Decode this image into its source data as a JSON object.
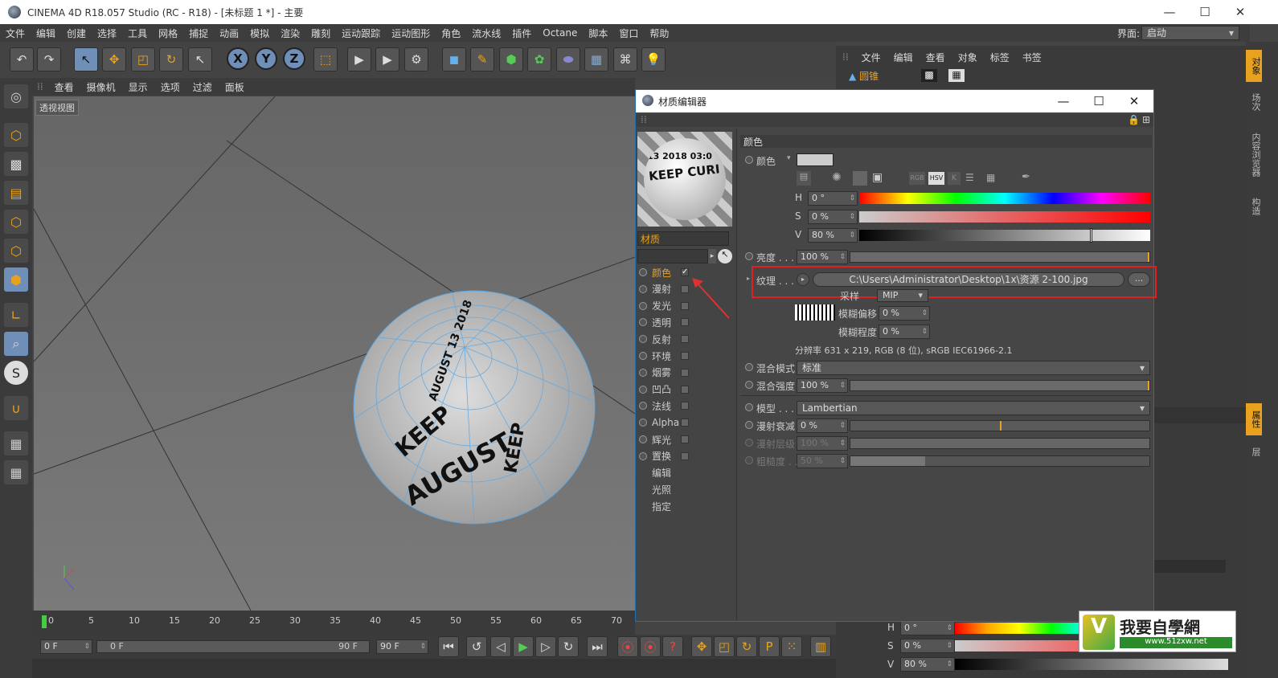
{
  "window": {
    "title": "CINEMA 4D R18.057 Studio (RC - R18) - [未标题 1 *] - 主要",
    "minimize": "—",
    "maximize": "☐",
    "close": "✕"
  },
  "menu": [
    "文件",
    "编辑",
    "创建",
    "选择",
    "工具",
    "网格",
    "捕捉",
    "动画",
    "模拟",
    "渲染",
    "雕刻",
    "运动跟踪",
    "运动图形",
    "角色",
    "流水线",
    "插件",
    "Octane",
    "脚本",
    "窗口",
    "帮助"
  ],
  "layout": {
    "label": "界面:",
    "value": "启动"
  },
  "axis": {
    "x": "X",
    "y": "Y",
    "z": "Z"
  },
  "viewport": {
    "menu": [
      "查看",
      "摄像机",
      "显示",
      "选项",
      "过滤",
      "面板"
    ],
    "label": "透视视图"
  },
  "timeline": {
    "ticks": [
      "0",
      "5",
      "10",
      "15",
      "20",
      "25",
      "30",
      "35",
      "40",
      "45",
      "50",
      "55",
      "60",
      "65",
      "70"
    ],
    "current": "0 F",
    "start": "0 F",
    "end": "90 F",
    "end_left": "90 F",
    "max": "90 F"
  },
  "right_panel": {
    "menu": [
      "文件",
      "编辑",
      "查看",
      "对象",
      "标签",
      "书签"
    ],
    "object": "圆锥",
    "tabs": [
      "对象",
      "场次",
      "内容浏览器",
      "构造",
      "属性",
      "层"
    ]
  },
  "bottom_right": {
    "h": "0 °",
    "s": "0 %",
    "v": "80 %",
    "h_label": "H",
    "s_label": "S",
    "v_label": "V"
  },
  "material_editor": {
    "title": "材质编辑器",
    "material_name": "材质",
    "channels": [
      {
        "name": "颜色",
        "checked": true,
        "active": true
      },
      {
        "name": "漫射",
        "checked": false
      },
      {
        "name": "发光",
        "checked": false
      },
      {
        "name": "透明",
        "checked": false
      },
      {
        "name": "反射",
        "checked": false
      },
      {
        "name": "环境",
        "checked": false
      },
      {
        "name": "烟雾",
        "checked": false
      },
      {
        "name": "凹凸",
        "checked": false
      },
      {
        "name": "法线",
        "checked": false
      },
      {
        "name": "Alpha",
        "checked": false
      },
      {
        "name": "辉光",
        "checked": false
      },
      {
        "name": "置换",
        "checked": false
      }
    ],
    "extra": [
      "编辑",
      "光照",
      "指定"
    ],
    "section": "颜色",
    "color_label": "颜色",
    "h_label": "H",
    "h": "0 °",
    "s_label": "S",
    "s": "0 %",
    "v_label": "V",
    "v": "80 %",
    "brightness_label": "亮度 . . .",
    "brightness": "100 %",
    "texture_label": "纹理 . . .",
    "texture_path": "C:\\Users\\Administrator\\Desktop\\1x\\资源 2-100.jpg",
    "texture_more": "...",
    "sampling_label": "采样",
    "sampling": "MIP",
    "blur_offset_label": "模糊偏移",
    "blur_offset": "0 %",
    "blur_scale_label": "模糊程度",
    "blur_scale": "0 %",
    "resolution": "分辨率 631 x 219, RGB (8 位), sRGB IEC61966-2.1",
    "mix_mode_label": "混合模式",
    "mix_mode": "标准",
    "mix_strength_label": "混合强度",
    "mix_strength": "100 %",
    "model_label": "模型 . . .",
    "model": "Lambertian",
    "diffuse_falloff_label": "漫射衰减",
    "diffuse_falloff": "0 %",
    "diffuse_level_label": "漫射层级",
    "diffuse_level": "100 %",
    "roughness_label": "粗糙度 . .",
    "roughness": "50 %",
    "color_modes": [
      "RGB",
      "HSV",
      "K"
    ]
  },
  "watermark": {
    "cn": "我要自學網",
    "url": "www.51zxw.net"
  },
  "colors": {
    "accent": "#e8a21f",
    "highlight_box": "#e02020",
    "arrow": "#e03030"
  }
}
